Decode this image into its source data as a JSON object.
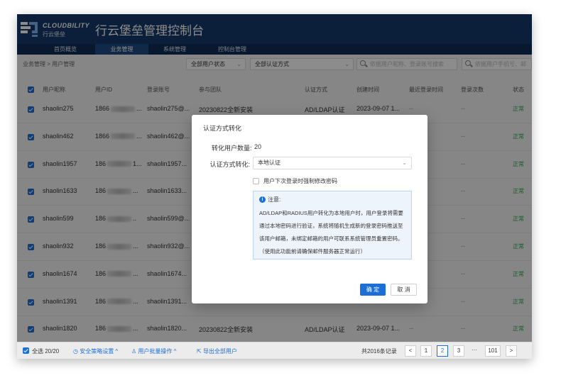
{
  "brand": {
    "name_en": "CLOUDBILITY",
    "name_cn": "行云堡垒"
  },
  "app_title": "行云堡垒管理控制台",
  "nav": [
    {
      "label": "首页概览"
    },
    {
      "label": "业务管理"
    },
    {
      "label": "系统管理"
    },
    {
      "label": "控制台管理"
    }
  ],
  "breadcrumb": "业务管理 > 用户管理",
  "filters": {
    "status": "全部用户状态",
    "auth": "全部认证方式",
    "search1": "依据用户昵称、登录账号搜索",
    "search2": "依据用户手机号、邮"
  },
  "table": {
    "headers": [
      "用户昵称",
      "用户ID",
      "登录账号",
      "参与团队",
      "认证方式",
      "创建时间",
      "最近登录时间",
      "登录次数",
      "状态"
    ],
    "rows": [
      {
        "nick": "shaolin275",
        "id": "1866",
        "id_suffix": "...",
        "account": "shaolin275@...",
        "team": "20230822全新安装",
        "auth": "AD/LDAP认证",
        "created": "2023-09-07 1...",
        "last": "--",
        "count": "--",
        "status": "正常"
      },
      {
        "nick": "shaolin462",
        "id": "1866",
        "id_suffix": "...",
        "account": "shaolin462@...",
        "team": "",
        "auth": "",
        "created": "",
        "last": "",
        "count": "--",
        "status": "正常"
      },
      {
        "nick": "shaolin1957",
        "id": "186",
        "id_suffix": "1...",
        "account": "shaolin1957...",
        "team": "",
        "auth": "",
        "created": "",
        "last": "",
        "count": "--",
        "status": "正常"
      },
      {
        "nick": "shaolin1633",
        "id": "186",
        "id_suffix": "...",
        "account": "shaolin1633...",
        "team": "",
        "auth": "",
        "created": "",
        "last": "",
        "count": "--",
        "status": "正常"
      },
      {
        "nick": "shaolin599",
        "id": "186",
        "id_suffix": "..",
        "account": "shaolin599@...",
        "team": "",
        "auth": "",
        "created": "",
        "last": "",
        "count": "--",
        "status": "正常"
      },
      {
        "nick": "shaolin932",
        "id": "186",
        "id_suffix": "...",
        "account": "shaolin932@...",
        "team": "",
        "auth": "",
        "created": "",
        "last": "",
        "count": "--",
        "status": "正常"
      },
      {
        "nick": "shaolin1674",
        "id": "186",
        "id_suffix": "...",
        "account": "shaolin1674...",
        "team": "",
        "auth": "",
        "created": "",
        "last": "",
        "count": "--",
        "status": "正常"
      },
      {
        "nick": "shaolin1391",
        "id": "186",
        "id_suffix": "...",
        "account": "shaolin1391...",
        "team": "",
        "auth": "",
        "created": "",
        "last": "",
        "count": "--",
        "status": "正常"
      },
      {
        "nick": "shaolin1820",
        "id": "186",
        "id_suffix": "...",
        "account": "shaolin1820...",
        "team": "20230822全新安装",
        "auth": "AD/LDAP认证",
        "created": "2023-09-07 1...",
        "last": "--",
        "count": "--",
        "status": "正常"
      }
    ]
  },
  "footer": {
    "select_all": "全选 20/20",
    "policy": "安全策略设置 ^",
    "batch": "用户批量操作 ^",
    "export": "导出全部用户",
    "total": "共2016条记录",
    "pages": [
      "<",
      "1",
      "2",
      "3",
      "···",
      "101",
      ">"
    ]
  },
  "modal": {
    "title": "认证方式转化",
    "count_label": "转化用户数量:",
    "count_value": "20",
    "method_label": "认证方式转化:",
    "method_value": "本地认证",
    "force_change": "用户下次登录时强制修改密码",
    "notice_title": "注意:",
    "notice_lines": [
      "AD/LDAP和RADIUS用户转化为本地用户时，用户登录将需要",
      "通过本地密码进行验证，系统将随机生成新的登录密码推送至",
      "该用户邮箱，未绑定邮箱的用户可联系系统管理员重置密码。",
      "（使用此功能前请确保邮件服务器正常运行）"
    ],
    "ok": "确 定",
    "cancel": "取 消"
  },
  "colors": {
    "topbar": "#153a6b",
    "accent": "#1d6fd8",
    "status_ok": "#2aa84a"
  }
}
